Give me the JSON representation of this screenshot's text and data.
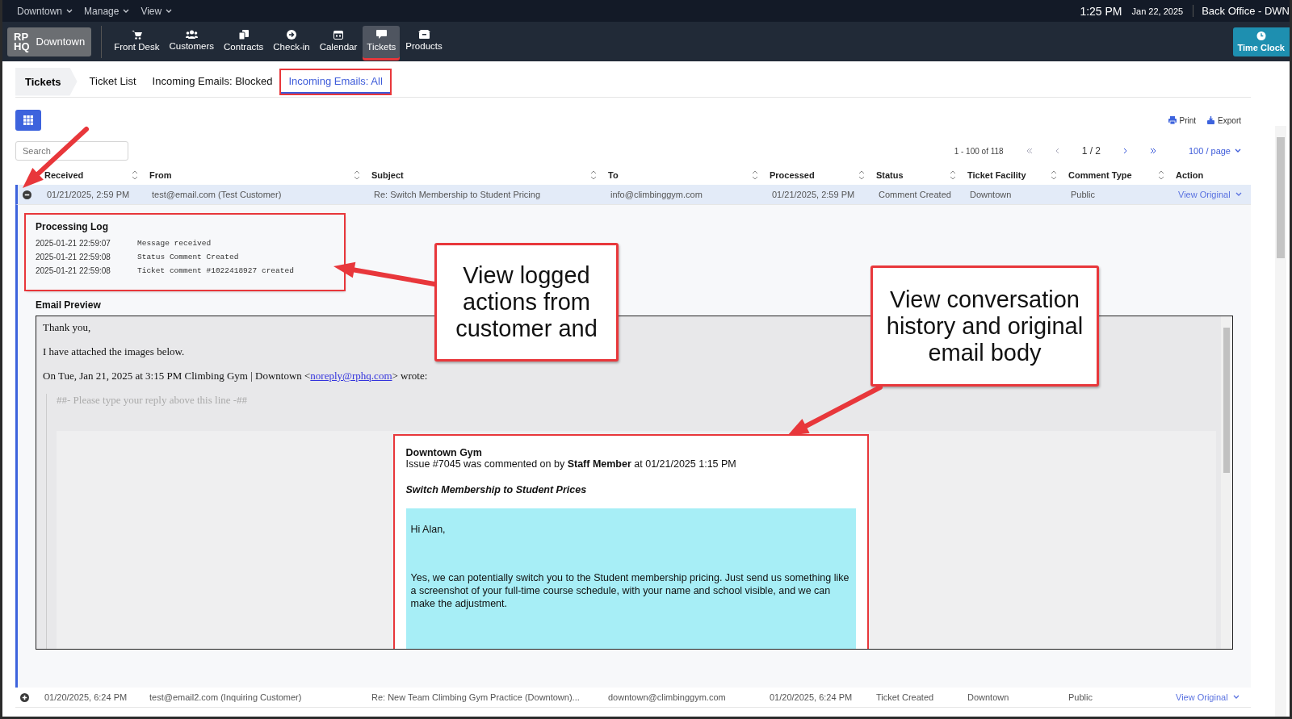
{
  "top_bar": {
    "menus": [
      "Downtown",
      "Manage",
      "View"
    ],
    "time": "1:25 PM",
    "date": "Jan 22, 2025",
    "user": "Back Office - DWN"
  },
  "nav": {
    "logo_lines": [
      "RP",
      "HQ"
    ],
    "location": "Downtown",
    "items": [
      {
        "label": "Front Desk",
        "selected": false,
        "annotated": false
      },
      {
        "label": "Customers",
        "selected": false,
        "annotated": false
      },
      {
        "label": "Contracts",
        "selected": false,
        "annotated": false
      },
      {
        "label": "Check-in",
        "selected": false,
        "annotated": false
      },
      {
        "label": "Calendar",
        "selected": false,
        "annotated": false
      },
      {
        "label": "Tickets",
        "selected": true,
        "annotated": true
      },
      {
        "label": "Products",
        "selected": false,
        "annotated": false
      }
    ],
    "time_clock": "Time Clock"
  },
  "breadcrumb": {
    "title": "Tickets",
    "tabs": [
      {
        "label": "Ticket List",
        "selected": false,
        "annotated": false
      },
      {
        "label": "Incoming Emails: Blocked",
        "selected": false,
        "annotated": false
      },
      {
        "label": "Incoming Emails: All",
        "selected": true,
        "annotated": true
      }
    ]
  },
  "toolbar": {
    "actions": [
      "Print",
      "Export"
    ],
    "search": {
      "placeholder": "Search"
    },
    "pagination": {
      "range": "1 - 100 of 118",
      "page": "1 / 2",
      "per_page": "100 / page"
    }
  },
  "table": {
    "columns": [
      "Received",
      "From",
      "Subject",
      "To",
      "Processed",
      "Status",
      "Ticket Facility",
      "Comment Type",
      "Action"
    ],
    "rows": [
      {
        "expanded": true,
        "cells": [
          "01/21/2025, 2:59 PM",
          "test@email.com (Test Customer)",
          "Re: Switch Membership to Student Pricing",
          "info@climbinggym.com",
          "01/21/2025, 2:59 PM",
          "Comment Created",
          "Downtown",
          "Public"
        ],
        "action": "View Original"
      },
      {
        "expanded": false,
        "cells": [
          "01/20/2025, 6:24 PM",
          "test@email2.com (Inquiring Customer)",
          "Re: New Team Climbing Gym Practice (Downtown)...",
          "downtown@climbinggym.com",
          "01/20/2025, 6:24 PM",
          "Ticket Created",
          "Downtown",
          "Public"
        ],
        "action": "View Original"
      }
    ]
  },
  "detail": {
    "processing_log": {
      "title": "Processing Log",
      "annotated": true,
      "entries": [
        {
          "time": "2025-01-21 22:59:07",
          "message": "Message received"
        },
        {
          "time": "2025-01-21 22:59:08",
          "message": "Status Comment Created"
        },
        {
          "time": "2025-01-21 22:59:08",
          "message": "Ticket comment #1022418927 created"
        }
      ]
    },
    "email_preview": {
      "title": "Email Preview",
      "paragraphs": [
        "Thank you,",
        "I have attached the images below."
      ],
      "quote_line": {
        "before": "On Tue, Jan 21, 2025 at 3:15 PM Climbing Gym | Downtown <",
        "link": "noreply@rphq.com",
        "after": "> wrote:"
      },
      "reply_marker": "##- Please type your reply above this line -##",
      "card": {
        "annotated": true,
        "sender": "Downtown Gym",
        "summary": "Issue #7045 was commented on by **Staff Member** at 01/21/2025 1:15 PM",
        "subject": "Switch Membership to Student Prices",
        "body": [
          "Hi Alan,",
          "Yes, we can potentially switch you to the Student membership pricing. Just send us something like a screenshot of your full-time course schedule, with your name and school visible, and we can make the adjustment."
        ]
      }
    }
  },
  "annotations": [
    "View logged actions from customer and",
    "View conversation history and original email body"
  ]
}
